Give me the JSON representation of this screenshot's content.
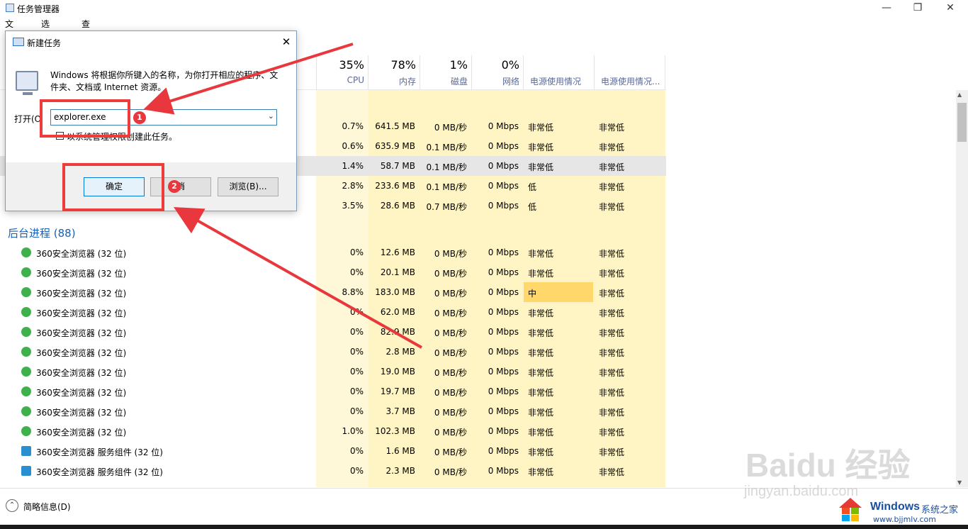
{
  "window": {
    "title": "任务管理器",
    "menu": [
      "文件(F)",
      "选项(O)",
      "查看(V)"
    ]
  },
  "columns": {
    "cpu": {
      "pct": "35%",
      "label": "CPU"
    },
    "mem": {
      "pct": "78%",
      "label": "内存"
    },
    "disk": {
      "pct": "1%",
      "label": "磁盘"
    },
    "net": {
      "pct": "0%",
      "label": "网络"
    },
    "power": {
      "label": "电源使用情况"
    },
    "power_trend": {
      "label": "电源使用情况..."
    }
  },
  "app_rows": [
    {
      "cpu": "0.7%",
      "mem": "641.5 MB",
      "disk": "0 MB/秒",
      "net": "0 Mbps",
      "power": "非常低",
      "trend": "非常低"
    },
    {
      "cpu": "0.6%",
      "mem": "635.9 MB",
      "disk": "0.1 MB/秒",
      "net": "0 Mbps",
      "power": "非常低",
      "trend": "非常低"
    },
    {
      "cpu": "1.4%",
      "mem": "58.7 MB",
      "disk": "0.1 MB/秒",
      "net": "0 Mbps",
      "power": "非常低",
      "trend": "非常低"
    },
    {
      "cpu": "2.8%",
      "mem": "233.6 MB",
      "disk": "0.1 MB/秒",
      "net": "0 Mbps",
      "power": "低",
      "trend": "非常低"
    },
    {
      "cpu": "3.5%",
      "mem": "28.6 MB",
      "disk": "0.7 MB/秒",
      "net": "0 Mbps",
      "power": "低",
      "trend": "非常低"
    }
  ],
  "background": {
    "heading": "后台进程 (88)",
    "rows": [
      {
        "name": "360安全浏览器 (32 位)",
        "cpu": "0%",
        "mem": "12.6 MB",
        "disk": "0 MB/秒",
        "net": "0 Mbps",
        "power": "非常低",
        "trend": "非常低"
      },
      {
        "name": "360安全浏览器 (32 位)",
        "cpu": "0%",
        "mem": "20.1 MB",
        "disk": "0 MB/秒",
        "net": "0 Mbps",
        "power": "非常低",
        "trend": "非常低"
      },
      {
        "name": "360安全浏览器 (32 位)",
        "cpu": "8.8%",
        "mem": "183.0 MB",
        "disk": "0 MB/秒",
        "net": "0 Mbps",
        "power": "中",
        "trend": "非常低"
      },
      {
        "name": "360安全浏览器 (32 位)",
        "cpu": "0%",
        "mem": "62.0 MB",
        "disk": "0 MB/秒",
        "net": "0 Mbps",
        "power": "非常低",
        "trend": "非常低"
      },
      {
        "name": "360安全浏览器 (32 位)",
        "cpu": "0%",
        "mem": "82.9 MB",
        "disk": "0 MB/秒",
        "net": "0 Mbps",
        "power": "非常低",
        "trend": "非常低"
      },
      {
        "name": "360安全浏览器 (32 位)",
        "cpu": "0%",
        "mem": "2.8 MB",
        "disk": "0 MB/秒",
        "net": "0 Mbps",
        "power": "非常低",
        "trend": "非常低"
      },
      {
        "name": "360安全浏览器 (32 位)",
        "cpu": "0%",
        "mem": "19.0 MB",
        "disk": "0 MB/秒",
        "net": "0 Mbps",
        "power": "非常低",
        "trend": "非常低"
      },
      {
        "name": "360安全浏览器 (32 位)",
        "cpu": "0%",
        "mem": "19.7 MB",
        "disk": "0 MB/秒",
        "net": "0 Mbps",
        "power": "非常低",
        "trend": "非常低"
      },
      {
        "name": "360安全浏览器 (32 位)",
        "cpu": "0%",
        "mem": "3.7 MB",
        "disk": "0 MB/秒",
        "net": "0 Mbps",
        "power": "非常低",
        "trend": "非常低"
      },
      {
        "name": "360安全浏览器 (32 位)",
        "cpu": "1.0%",
        "mem": "102.3 MB",
        "disk": "0 MB/秒",
        "net": "0 Mbps",
        "power": "非常低",
        "trend": "非常低"
      },
      {
        "name": "360安全浏览器 服务组件 (32 位)",
        "cpu": "0%",
        "mem": "1.6 MB",
        "disk": "0 MB/秒",
        "net": "0 Mbps",
        "power": "非常低",
        "trend": "非常低",
        "svc": true
      },
      {
        "name": "360安全浏览器 服务组件 (32 位)",
        "cpu": "0%",
        "mem": "2.3 MB",
        "disk": "0 MB/秒",
        "net": "0 Mbps",
        "power": "非常低",
        "trend": "非常低",
        "svc": true
      }
    ]
  },
  "footer": {
    "label": "简略信息(D)"
  },
  "dialog": {
    "title": "新建任务",
    "description": "Windows 将根据你所键入的名称，为你打开相应的程序、文件夹、文档或 Internet 资源。",
    "open_label": "打开(O",
    "input_value": "explorer.exe",
    "checkbox_label": "以系统管理权限创建此任务。",
    "ok_label": "确定",
    "cancel_label": "消",
    "browse_label": "浏览(B)..."
  },
  "annotations": {
    "badge1": "1",
    "badge2": "2"
  },
  "watermark": {
    "brand": "Baidu 经验",
    "sub": "jingyan.baidu.com",
    "windows": "Windows",
    "site_name": "系统之家",
    "site_url": "www.bjjmlv.com"
  },
  "colors": {
    "heat": "#fff4c4",
    "selected": "#e6e6e6",
    "medium": "#ffd76a",
    "accent": "#1a5fb4",
    "annotation": "#e8383d"
  }
}
